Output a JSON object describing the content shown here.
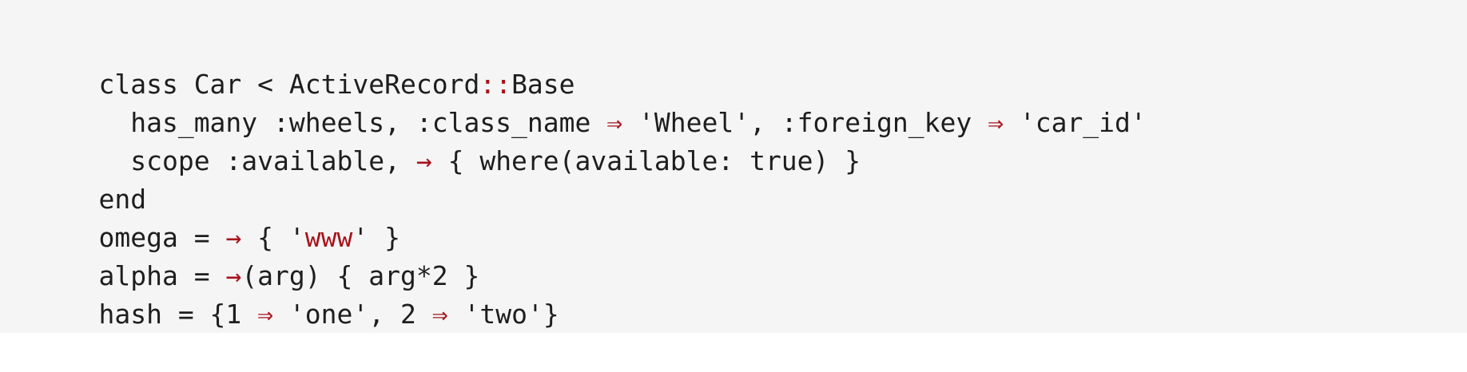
{
  "code": {
    "lines": [
      [
        {
          "t": "class Car < ActiveRecord",
          "k": "plain"
        },
        {
          "t": "::",
          "k": "op"
        },
        {
          "t": "Base",
          "k": "plain"
        }
      ],
      [
        {
          "t": "  has_many :wheels, :class_name ",
          "k": "plain"
        },
        {
          "t": "⇒",
          "k": "op"
        },
        {
          "t": " 'Wheel', :foreign_key ",
          "k": "plain"
        },
        {
          "t": "⇒",
          "k": "op"
        },
        {
          "t": " 'car_id'",
          "k": "plain"
        }
      ],
      [
        {
          "t": "  scope :available, ",
          "k": "plain"
        },
        {
          "t": "→",
          "k": "op"
        },
        {
          "t": " { where(available: true) }",
          "k": "plain"
        }
      ],
      [
        {
          "t": "end",
          "k": "plain"
        }
      ],
      [
        {
          "t": "omega = ",
          "k": "plain"
        },
        {
          "t": "→",
          "k": "op"
        },
        {
          "t": " { '",
          "k": "plain"
        },
        {
          "t": "www",
          "k": "op"
        },
        {
          "t": "' }",
          "k": "plain"
        }
      ],
      [
        {
          "t": "alpha = ",
          "k": "plain"
        },
        {
          "t": "→",
          "k": "op"
        },
        {
          "t": "(arg) { arg*2 }",
          "k": "plain"
        }
      ],
      [
        {
          "t": "hash = {1 ",
          "k": "plain"
        },
        {
          "t": "⇒",
          "k": "op"
        },
        {
          "t": " 'one', 2 ",
          "k": "plain"
        },
        {
          "t": "⇒",
          "k": "op"
        },
        {
          "t": " 'two'}",
          "k": "plain"
        }
      ]
    ],
    "colors": {
      "background": "#f5f5f5",
      "text": "#1e1e1e",
      "operator": "#a8131b"
    }
  }
}
